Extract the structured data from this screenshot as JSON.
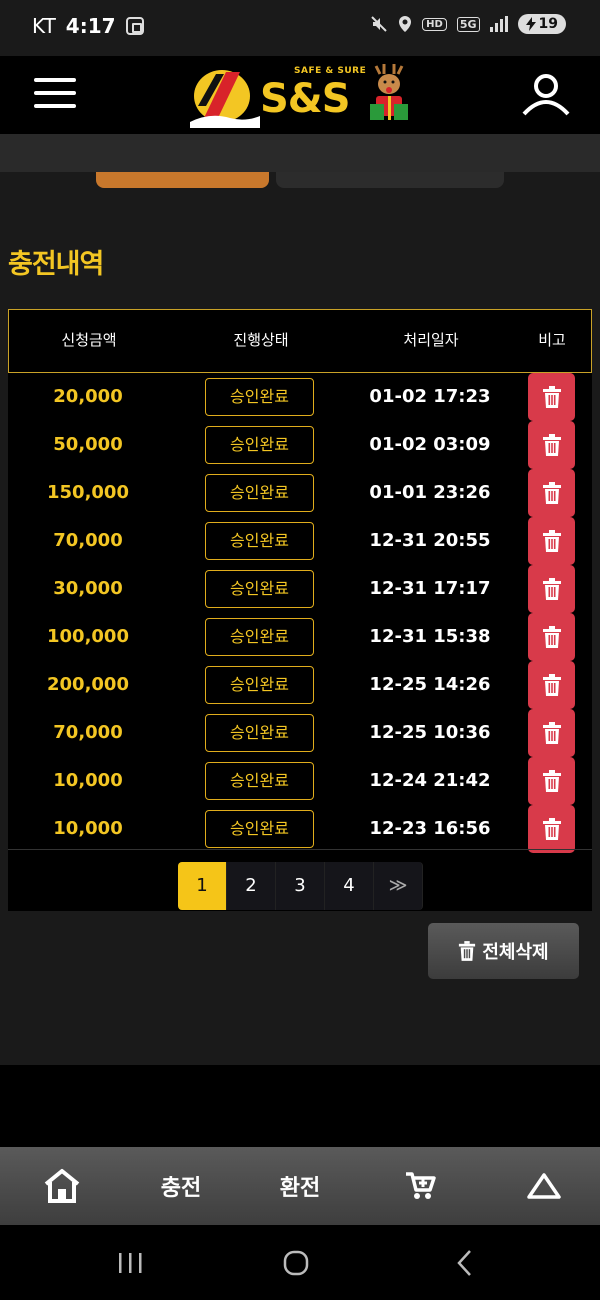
{
  "status_bar": {
    "carrier": "KT",
    "time": "4:17",
    "hd": "HD",
    "network": "5G",
    "battery": "19"
  },
  "header": {
    "logo_tagline": "SAFE & SURE",
    "logo_text": "S&S"
  },
  "page": {
    "section_title": "충전내역",
    "columns": [
      "신청금액",
      "진행상태",
      "처리일자",
      "비고"
    ]
  },
  "rows": [
    {
      "amount": "20,000",
      "status": "승인완료",
      "date": "01-02 17:23"
    },
    {
      "amount": "50,000",
      "status": "승인완료",
      "date": "01-02 03:09"
    },
    {
      "amount": "150,000",
      "status": "승인완료",
      "date": "01-01 23:26"
    },
    {
      "amount": "70,000",
      "status": "승인완료",
      "date": "12-31 20:55"
    },
    {
      "amount": "30,000",
      "status": "승인완료",
      "date": "12-31 17:17"
    },
    {
      "amount": "100,000",
      "status": "승인완료",
      "date": "12-31 15:38"
    },
    {
      "amount": "200,000",
      "status": "승인완료",
      "date": "12-25 14:26"
    },
    {
      "amount": "70,000",
      "status": "승인완료",
      "date": "12-25 10:36"
    },
    {
      "amount": "10,000",
      "status": "승인완료",
      "date": "12-24 21:42"
    },
    {
      "amount": "10,000",
      "status": "승인완료",
      "date": "12-23 16:56"
    }
  ],
  "pagination": {
    "pages": [
      "1",
      "2",
      "3",
      "4"
    ],
    "current": "1",
    "next": "≫"
  },
  "actions": {
    "delete_all": "전체삭제"
  },
  "bottom_nav": {
    "charge": "충전",
    "exchange": "환전"
  },
  "colors": {
    "accent_gold": "#f3c623",
    "delete_red": "#d83a4a",
    "tab_orange": "#c8782c"
  },
  "icons": {
    "delete": "trash-icon",
    "home": "home-icon",
    "cart": "cart-icon",
    "up": "triangle-up-icon",
    "menu": "hamburger-icon",
    "user": "user-icon"
  }
}
